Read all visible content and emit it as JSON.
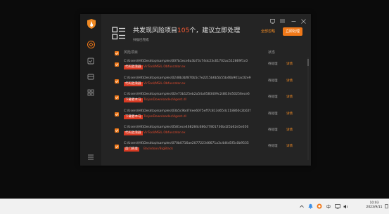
{
  "window": {
    "header": {
      "title_prefix": "共发现风险项目",
      "risk_count": "105",
      "title_suffix": "个，建议立即处理",
      "subtitle": "扫描已完成",
      "ignore_all": "全部忽略",
      "fix_now": "立即处理"
    },
    "table": {
      "col_item": "风险项目",
      "col_status": "状态"
    },
    "rows": [
      {
        "path": "C:\\Users\\HK\\Desktop\\samples\\007b1ece6a3b73c74dc23c61702ac512869f1c0",
        "tag": "代码混淆器",
        "name": "VirTool/MSIL.Obfuscator.ex",
        "status": "待处理",
        "detail": "详情"
      },
      {
        "path": "C:\\Users\\HK\\Desktop\\samples\\02d8b3bf870b5c7e2215b6b5b55b46b901ac02e9",
        "tag": "代码混淆器",
        "name": "VirTool/MSIL.Obfuscator.ex",
        "status": "待处理",
        "detail": "详情"
      },
      {
        "path": "C:\\Users\\HK\\Desktop\\samples\\02e73b125eb2a54a0583409c2d810d50256ece6",
        "tag": "下载者木马",
        "name": "TrojanDownloader/Agent.dl",
        "status": "待处理",
        "detail": "详情"
      },
      {
        "path": "C:\\Users\\HK\\Desktop\\samples\\03b5c9bd74ee6075eff7c813d65dc118860c2b02f",
        "tag": "下载者木马",
        "name": "TrojanDownloader/Agent.dl",
        "status": "待处理",
        "detail": "详情"
      },
      {
        "path": "C:\\Users\\HK\\Desktop\\samples\\0581ece468284c686cf7801736bd25b62e5e056",
        "tag": "代码混淆器",
        "name": "VirTool/MSIL.Obfuscator.ex",
        "status": "待处理",
        "detail": "详情"
      },
      {
        "path": "C:\\Users\\HK\\Desktop\\samples\\070b0716ae207722346671a3c4d4d5f5c0b9535",
        "tag": "后门病毒",
        "name": "Backdoor/BigBlack",
        "status": "待处理",
        "detail": "详情"
      }
    ]
  },
  "taskbar": {
    "ime": "中",
    "time": "10:03",
    "date": "2023/9/11"
  },
  "colors": {
    "accent": "#f07818",
    "danger": "#d93a23",
    "window_bg": "#242424",
    "sidebar_bg": "#1d1d1d"
  },
  "icons": [
    "shield-logo-icon",
    "shield-icon",
    "virus-scan-icon",
    "toolbox-icon",
    "apps-icon",
    "menu-icon",
    "feedback-icon",
    "menu-lines-icon",
    "minimize-icon",
    "close-icon",
    "report-list-icon",
    "checkmark-icon",
    "chevron-up-icon",
    "bell-icon",
    "security-tray-icon",
    "input-method-icon",
    "network-icon",
    "volume-icon",
    "notification-icon"
  ]
}
